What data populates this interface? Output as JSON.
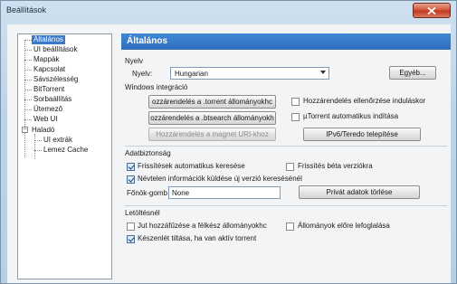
{
  "window": {
    "title": "Beállítások"
  },
  "tree": {
    "items": [
      {
        "label": "Általános",
        "selected": true
      },
      {
        "label": "UI beállítások"
      },
      {
        "label": "Mappák"
      },
      {
        "label": "Kapcsolat"
      },
      {
        "label": "Sávszélesség"
      },
      {
        "label": "BitTorrent"
      },
      {
        "label": "Sorbaállítás"
      },
      {
        "label": "Ütemező"
      },
      {
        "label": "Web UI"
      },
      {
        "label": "Haladó"
      },
      {
        "label": "UI extrák"
      },
      {
        "label": "Lemez Cache"
      }
    ]
  },
  "panel": {
    "header": "Általános",
    "language": {
      "group_label": "Nyelv",
      "field_label": "Nyelv:",
      "selected": "Hungarian",
      "other_button": "Egyéb..."
    },
    "windows": {
      "group_label": "Windows integráció",
      "btn_torrent": "ozzárendelés a .torrent állományokhc",
      "btn_btsearch": "ozzárendelés a .btsearch állományokh",
      "btn_magnet": "Hozzárendelés a magnet URI-khoz",
      "chk_check_assoc": "Hozzárendelés ellenőrzése induláskor",
      "chk_autostart": "µTorrent automatikus indítása",
      "btn_ipv6": "IPv6/Teredo telepítése"
    },
    "privacy": {
      "group_label": "Adatbiztonság",
      "chk_auto_update": "Frissítések automatikus keresése",
      "chk_beta": "Frissítés béta verziókra",
      "chk_anonymous": "Névtelen információk küldése új verzió keresésénél",
      "boss_label": "Főnök-gomb",
      "boss_value": "None",
      "btn_clear_private": "Privát adatok törlése"
    },
    "downloads": {
      "group_label": "Letöltésnél",
      "chk_append": "Jut hozzáfűzése a félkész állományokhc",
      "chk_prealloc": "Állományok előre lefoglalása",
      "chk_standby": "Készenlét tiltása, ha  van aktív torrent"
    }
  }
}
